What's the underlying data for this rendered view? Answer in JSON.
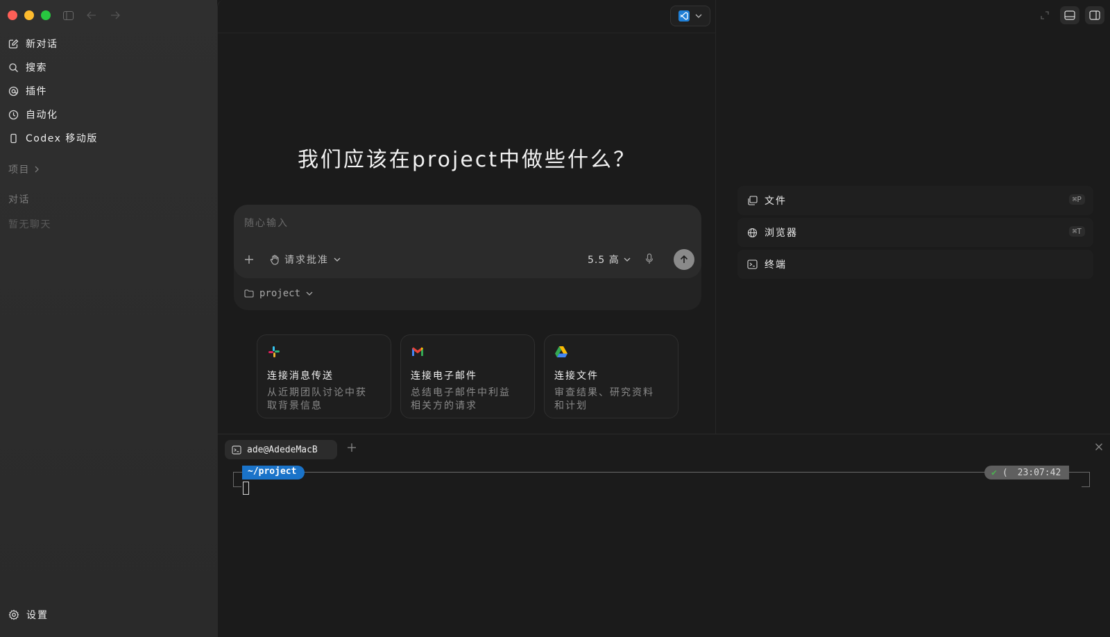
{
  "sidebar": {
    "items": [
      {
        "label": "新对话",
        "icon": "edit-icon"
      },
      {
        "label": "搜索",
        "icon": "search-icon"
      },
      {
        "label": "插件",
        "icon": "at-icon"
      },
      {
        "label": "自动化",
        "icon": "clock-icon"
      },
      {
        "label": "Codex 移动版",
        "icon": "phone-icon"
      }
    ],
    "projects_label": "项目",
    "conversations_label": "对话",
    "empty_label": "暂无聊天",
    "settings_label": "设置"
  },
  "main": {
    "heading": "我们应该在project中做些什么？",
    "composer": {
      "placeholder": "随心输入",
      "approval_label": "请求批准",
      "model_label": "5.5 高",
      "project_label": "project"
    },
    "cards": [
      {
        "title": "连接消息传送",
        "desc_line1": "从近期团队讨论中获",
        "desc_line2": "取背景信息",
        "icon": "slack-icon"
      },
      {
        "title": "连接电子邮件",
        "desc_line1": "总结电子邮件中利益",
        "desc_line2": "相关方的请求",
        "icon": "gmail-icon"
      },
      {
        "title": "连接文件",
        "desc_line1": "审查结果、研究资料",
        "desc_line2": "和计划",
        "icon": "drive-icon"
      }
    ]
  },
  "right_panel": {
    "items": [
      {
        "label": "文件",
        "shortcut": "⌘P",
        "icon": "files-icon"
      },
      {
        "label": "浏览器",
        "shortcut": "⌘T",
        "icon": "globe-icon"
      },
      {
        "label": "终端",
        "shortcut": "",
        "icon": "terminal-icon"
      }
    ]
  },
  "terminal": {
    "tab_label": "ade@AdedeMacB",
    "path": "~/project",
    "check": "✔",
    "paren": "(",
    "time": "23:07:42"
  },
  "colors": {
    "traffic_red": "#fe5f57",
    "traffic_yellow": "#febc2e",
    "traffic_green": "#28c840",
    "path_blue": "#1a73c9"
  }
}
